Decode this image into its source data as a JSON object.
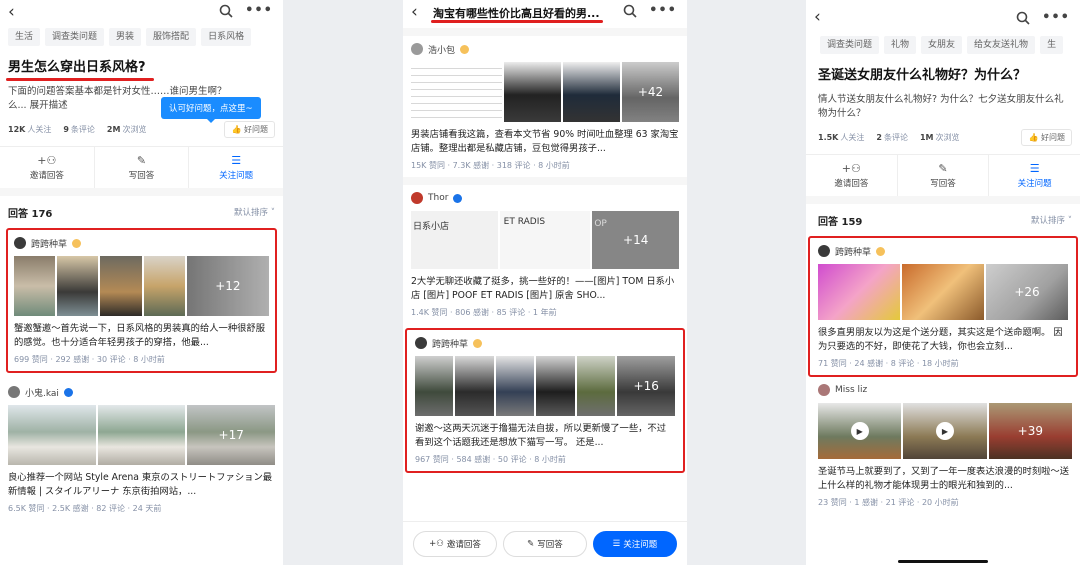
{
  "screen1": {
    "tags": [
      "生活",
      "调查类问题",
      "男装",
      "服饰搭配",
      "日系风格"
    ],
    "question_title": "男生怎么穿出日系风格?",
    "description": "下面的问题答案基本都是针对女性……谁问男生啊？",
    "description_more": "么... 展开描述",
    "tooltip": "认可好问题，点这里~",
    "followers": "12K",
    "followers_label": "人关注",
    "comments": "9",
    "comments_label": "条评论",
    "views": "2M",
    "views_label": "次浏览",
    "good_question": "好问题",
    "actions": [
      "邀请回答",
      "写回答",
      "关注问题"
    ],
    "answers_count": "回答 176",
    "sort": "默认排序",
    "answers": [
      {
        "author": "跨跨种草",
        "plus": "+12",
        "excerpt": "蟹邀蟹邀～首先说一下，日系风格的男装真的给人一种很舒服的感觉。也十分适合年轻男孩子的穿搭，他最...",
        "meta": "699 赞同 · 292 感谢 · 30 评论 · 8 小时前"
      },
      {
        "author": "小鬼.kai",
        "plus": "+17",
        "excerpt": "良心推荐一个网站 Style Arena 東京のストリートファション最新情報 | スタイルアリーナ 东京街拍网站，...",
        "meta": "6.5K 赞同 · 2.5K 感谢 · 82 评论 · 24 天前"
      }
    ]
  },
  "screen2": {
    "title": "淘宝有哪些性价比高且好看的男...",
    "answers": [
      {
        "author": "浩小包",
        "plus": "+42",
        "excerpt": "男装店铺看我这篇，查看本文节省 90% 时间吐血整理 63 家淘宝店铺。整理出都是私藏店铺，豆包觉得男孩子...",
        "meta": "15K 赞同 · 7.3K 感谢 · 318 评论 · 8 小时前"
      },
      {
        "author": "Thor",
        "img_texts": [
          "日系小店",
          "ET RADIS",
          "OP"
        ],
        "plus": "+14",
        "excerpt": "2大学无聊还收藏了挺多，挑一些好的！——[图片] TOM 日系小店 [图片] POOF ET RADIS [图片] 原舍 SHO...",
        "meta": "1.4K 赞同 · 806 感谢 · 85 评论 · 1 年前"
      },
      {
        "author": "跨跨种草",
        "plus": "+16",
        "excerpt": "谢邀～这两天沉迷于撸猫无法自拔，所以更新慢了一些，不过看到这个话题我还是想放下猫写一写。 还是...",
        "meta": "967 赞同 · 584 感谢 · 50 评论 · 8 小时前"
      }
    ],
    "bottom": [
      "邀请回答",
      "写回答",
      "关注问题"
    ]
  },
  "screen3": {
    "tags": [
      "调查类问题",
      "礼物",
      "女朋友",
      "给女友送礼物",
      "生"
    ],
    "question_title": "圣诞送女朋友什么礼物好？为什么？",
    "description": "情人节送女朋友什么礼物好? 为什么？七夕送女朋友什么礼物为什么？",
    "followers": "1.5K",
    "followers_label": "人关注",
    "comments": "2",
    "comments_label": "条评论",
    "views": "1M",
    "views_label": "次浏览",
    "good_question": "好问题",
    "actions": [
      "邀请回答",
      "写回答",
      "关注问题"
    ],
    "answers_count": "回答 159",
    "sort": "默认排序",
    "answers": [
      {
        "author": "跨跨种草",
        "plus": "+26",
        "excerpt": "很多直男朋友以为这是个送分题，其实这是个送命题啊。 因为只要选的不好，即使花了大钱，你也会立刻...",
        "meta": "71 赞同 · 24 感谢 · 8 评论 · 18 小时前"
      },
      {
        "author": "Miss liz",
        "plus": "+39",
        "excerpt": "圣诞节马上就要到了，又到了一年一度表达浪漫的时刻啦～送上什么样的礼物才能体现男士的眼光和独到的...",
        "meta": "23 赞同 · 1 感谢 · 21 评论 · 20 小时前"
      }
    ]
  },
  "colors": {
    "accent": "#0066ff",
    "highlight": "#e02020",
    "tooltip": "#1a8cff"
  }
}
